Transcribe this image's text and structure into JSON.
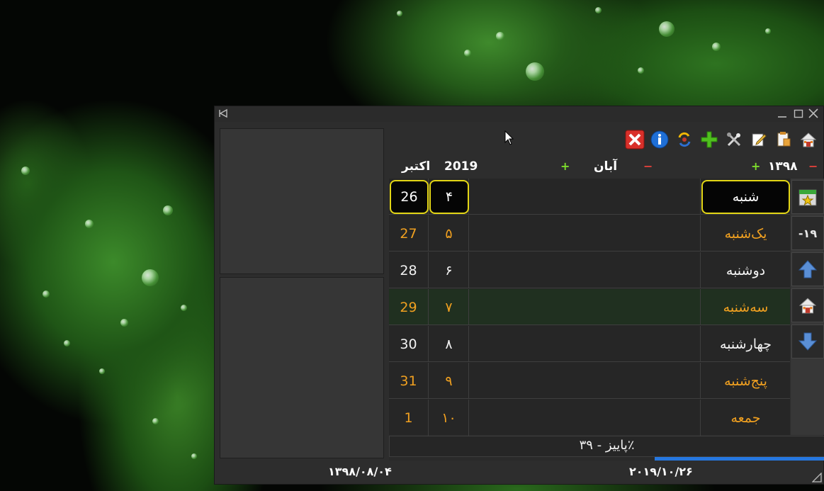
{
  "window": {
    "toolbar": {
      "icons": [
        "home-icon",
        "clipboard-edit-icon",
        "notes-icon",
        "tools-icon",
        "add-icon",
        "swap-icon",
        "info-icon",
        "close-app-icon"
      ]
    },
    "header": {
      "shamsi_year": "۱۳۹۸",
      "shamsi_month": "آبان",
      "greg_year": "2019",
      "greg_month": "اکتبر"
    },
    "days": [
      {
        "name": "شنبه",
        "shamsi": "۴",
        "greg": "26",
        "style": "today"
      },
      {
        "name": "یک‌شنبه",
        "shamsi": "۵",
        "greg": "27",
        "style": "orange"
      },
      {
        "name": "دوشنبه",
        "shamsi": "۶",
        "greg": "28",
        "style": "white"
      },
      {
        "name": "سه‌شنبه",
        "shamsi": "۷",
        "greg": "29",
        "style": "highlight"
      },
      {
        "name": "چهارشنبه",
        "shamsi": "۸",
        "greg": "30",
        "style": "white"
      },
      {
        "name": "پنج‌شنبه",
        "shamsi": "۹",
        "greg": "31",
        "style": "orange"
      },
      {
        "name": "جمعه",
        "shamsi": "۱۰",
        "greg": "1",
        "style": "orange"
      }
    ],
    "sidenav": {
      "offset_label": "-۱۹"
    },
    "season": {
      "label": "پاییز - ۳۹٪",
      "progress": 0.39
    },
    "status": {
      "gregorian_date": "۲۰۱۹/۱۰/۲۶",
      "shamsi_date": "۱۳۹۸/۰۸/۰۴"
    },
    "colors": {
      "accent_yellow": "#e3d615",
      "weekend_orange": "#f0a020",
      "progress_blue": "#2577e0",
      "plus_green": "#7ddc2c",
      "minus_red": "#e0403a"
    }
  }
}
